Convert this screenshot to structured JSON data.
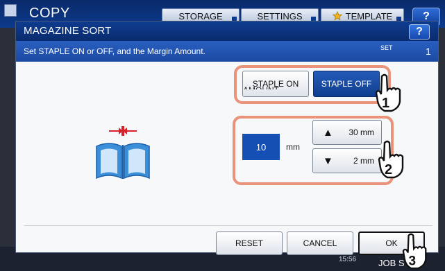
{
  "app": {
    "title": "COPY",
    "tabs": [
      "STORAGE",
      "SETTINGS",
      "TEMPLATE"
    ],
    "help_label": "?",
    "clock": "15:56",
    "job_status_label": "JOB S"
  },
  "dialog": {
    "title": "MAGAZINE SORT",
    "help_label": "?",
    "instruction": "Set STAPLE ON or OFF, and the Margin Amount.",
    "set_label": "SET",
    "set_count": "1",
    "staple_on_label": "STAPLE ON",
    "staple_off_label": "STAPLE OFF",
    "staple_selected": "STAPLE OFF",
    "amount_label": "AMOUNT",
    "amount_value": "10",
    "amount_unit": "mm",
    "increase_label": "30 mm",
    "decrease_label": "2 mm",
    "reset_label": "RESET",
    "cancel_label": "CANCEL",
    "ok_label": "OK"
  },
  "callouts": [
    "1",
    "2",
    "3"
  ],
  "colors": {
    "header_blue": "#0f3c90",
    "selected_blue": "#1450b4",
    "halo_salmon": "#e8937a",
    "book_blue": "#3a8fd8",
    "margin_arrow_red": "#d8202a"
  },
  "icons": [
    "star-icon",
    "chevron-down-icon",
    "up-arrow-icon",
    "down-arrow-icon",
    "open-book-icon",
    "margin-arrows-icon",
    "pointing-hand-icon"
  ]
}
